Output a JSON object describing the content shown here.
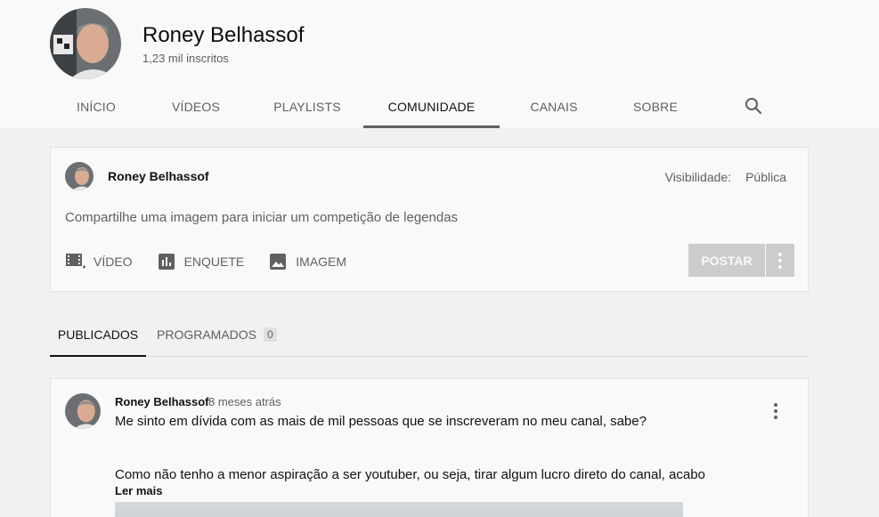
{
  "channel": {
    "name": "Roney Belhassof",
    "subscribers": "1,23 mil inscritos"
  },
  "tabs": [
    {
      "label": "INÍCIO"
    },
    {
      "label": "VÍDEOS"
    },
    {
      "label": "PLAYLISTS"
    },
    {
      "label": "COMUNIDADE",
      "active": true
    },
    {
      "label": "CANAIS"
    },
    {
      "label": "SOBRE"
    }
  ],
  "composer": {
    "author": "Roney Belhassof",
    "visibility_label": "Visibilidade:",
    "visibility_value": "Pública",
    "prompt": "Compartilhe uma imagem para iniciar um competição de legendas",
    "actions": {
      "video": "VÍDEO",
      "poll": "ENQUETE",
      "image": "IMAGEM"
    },
    "post_button": "POSTAR"
  },
  "subtabs": {
    "published": "PUBLICADOS",
    "scheduled": "PROGRAMADOS",
    "scheduled_count": "0"
  },
  "post": {
    "author": "Roney Belhassof",
    "time": "8 meses atrás",
    "line1": "Me sinto em dívida com as mais de mil pessoas que se inscreveram no meu canal, sabe?",
    "line2": "Como não tenho a menor aspiração a ser youtuber, ou seja, tirar algum lucro direto do canal, acabo",
    "read_more": "Ler mais"
  },
  "colors": {
    "header_bg": "#f9f9f9",
    "page_bg": "#f1f1f1",
    "text_primary": "#111111",
    "text_secondary": "#606060",
    "button_disabled": "#cccccc"
  }
}
